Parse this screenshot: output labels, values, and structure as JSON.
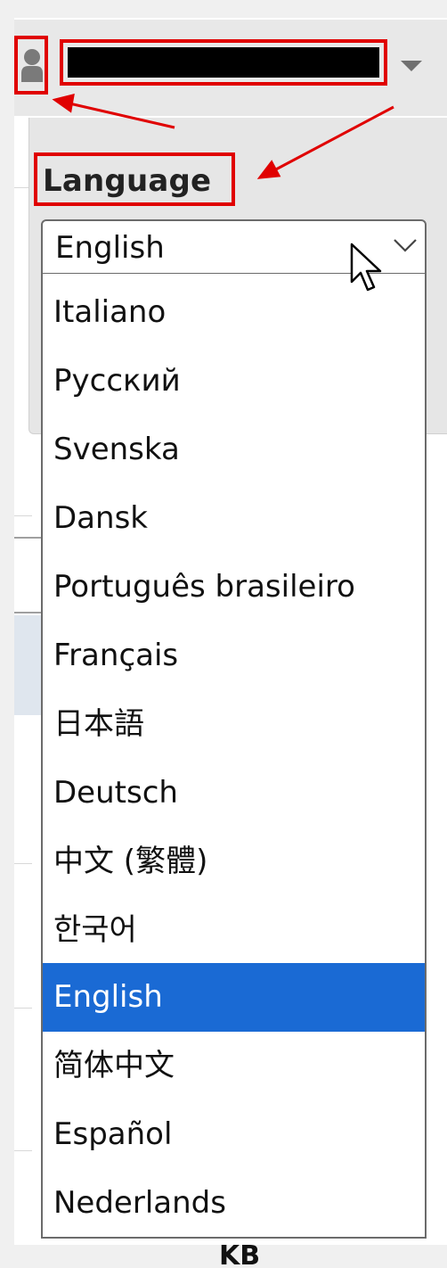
{
  "header": {
    "avatar_icon": "user-silhouette-icon",
    "username_redacted": true,
    "menu_caret_icon": "caret-down-icon"
  },
  "language": {
    "label": "Language",
    "selected_value": "English",
    "options": [
      "Italiano",
      "Русский",
      "Svenska",
      "Dansk",
      "Português brasileiro",
      "Français",
      "日本語",
      "Deutsch",
      "中文 (繁體)",
      "한국어",
      "English",
      "简体中文",
      "Español",
      "Nederlands"
    ],
    "highlighted_index": 10
  },
  "background_text": {
    "fragment": "KB"
  },
  "colors": {
    "highlight": "#1a6ad4",
    "annotation": "#e00000",
    "panel": "#e6e6e6"
  }
}
